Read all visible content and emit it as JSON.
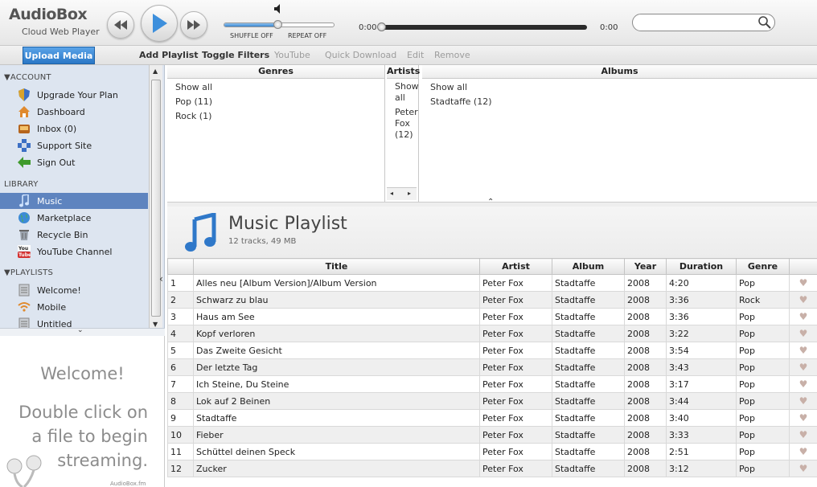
{
  "app": {
    "name": "AudioBox",
    "subtitle": "Cloud Web Player"
  },
  "player": {
    "shuffle_label": "SHUFFLE OFF",
    "repeat_label": "REPEAT OFF",
    "elapsed": "0:00",
    "remaining": "0:00",
    "volume_level": 0.5,
    "progress": 0.0
  },
  "search": {
    "value": "",
    "placeholder": ""
  },
  "toolbar": {
    "upload": "Upload Media",
    "add_playlist": "Add Playlist",
    "toggle_filters": "Toggle Filters",
    "youtube": "YouTube",
    "quick_download": "Quick Download",
    "edit": "Edit",
    "remove": "Remove"
  },
  "sidebar": {
    "account_head": "ACCOUNT",
    "account": [
      {
        "label": "Upgrade Your Plan",
        "icon": "shield-icon"
      },
      {
        "label": "Dashboard",
        "icon": "home-icon"
      },
      {
        "label": "Inbox (0)",
        "icon": "inbox-icon"
      },
      {
        "label": "Support Site",
        "icon": "support-icon"
      },
      {
        "label": "Sign Out",
        "icon": "sign-out-icon"
      }
    ],
    "library_head": "LIBRARY",
    "library": [
      {
        "label": "Music",
        "icon": "music-note-icon",
        "active": true
      },
      {
        "label": "Marketplace",
        "icon": "globe-icon"
      },
      {
        "label": "Recycle Bin",
        "icon": "recycle-bin-icon"
      },
      {
        "label": "YouTube Channel",
        "icon": "youtube-icon"
      }
    ],
    "playlists_head": "PLAYLISTS",
    "playlists": [
      {
        "label": "Welcome!",
        "icon": "playlist-icon"
      },
      {
        "label": "Mobile",
        "icon": "wifi-icon"
      },
      {
        "label": "Untitled",
        "icon": "playlist-icon"
      }
    ]
  },
  "welcome": {
    "title": "Welcome!",
    "line1": "Double click on",
    "line2": "a file to begin",
    "line3": "streaming.",
    "brand": "AudioBox.fm"
  },
  "browser": {
    "genres_head": "Genres",
    "genres": [
      "Show all",
      "Pop (11)",
      "Rock (1)"
    ],
    "artists_head": "Artists",
    "artists": [
      "Show",
      "all",
      "Peter",
      "Fox",
      "(12)"
    ],
    "albums_head": "Albums",
    "albums": [
      "Show all",
      "Stadtaffe (12)"
    ]
  },
  "playlist": {
    "title": "Music Playlist",
    "summary": "12 tracks, 49 MB"
  },
  "table": {
    "headers": [
      "",
      "Title",
      "Artist",
      "Album",
      "Year",
      "Duration",
      "Genre",
      ""
    ],
    "rows": [
      [
        "1",
        "Alles neu [Album Version]/Album Version",
        "Peter Fox",
        "Stadtaffe",
        "2008",
        "4:20",
        "Pop"
      ],
      [
        "2",
        "Schwarz zu blau",
        "Peter Fox",
        "Stadtaffe",
        "2008",
        "3:36",
        "Rock"
      ],
      [
        "3",
        "Haus am See",
        "Peter Fox",
        "Stadtaffe",
        "2008",
        "3:36",
        "Pop"
      ],
      [
        "4",
        "Kopf verloren",
        "Peter Fox",
        "Stadtaffe",
        "2008",
        "3:22",
        "Pop"
      ],
      [
        "5",
        "Das Zweite Gesicht",
        "Peter Fox",
        "Stadtaffe",
        "2008",
        "3:54",
        "Pop"
      ],
      [
        "6",
        "Der letzte Tag",
        "Peter Fox",
        "Stadtaffe",
        "2008",
        "3:43",
        "Pop"
      ],
      [
        "7",
        "Ich Steine, Du Steine",
        "Peter Fox",
        "Stadtaffe",
        "2008",
        "3:17",
        "Pop"
      ],
      [
        "8",
        "Lok auf 2 Beinen",
        "Peter Fox",
        "Stadtaffe",
        "2008",
        "3:44",
        "Pop"
      ],
      [
        "9",
        "Stadtaffe",
        "Peter Fox",
        "Stadtaffe",
        "2008",
        "3:40",
        "Pop"
      ],
      [
        "10",
        "Fieber",
        "Peter Fox",
        "Stadtaffe",
        "2008",
        "3:33",
        "Pop"
      ],
      [
        "11",
        "Schüttel deinen Speck",
        "Peter Fox",
        "Stadtaffe",
        "2008",
        "2:51",
        "Pop"
      ],
      [
        "12",
        "Zucker",
        "Peter Fox",
        "Stadtaffe",
        "2008",
        "3:12",
        "Pop"
      ]
    ]
  },
  "colors": {
    "accent": "#2a77c6",
    "sidebar_bg": "#dde5f0",
    "active_row": "#5e84bf"
  }
}
